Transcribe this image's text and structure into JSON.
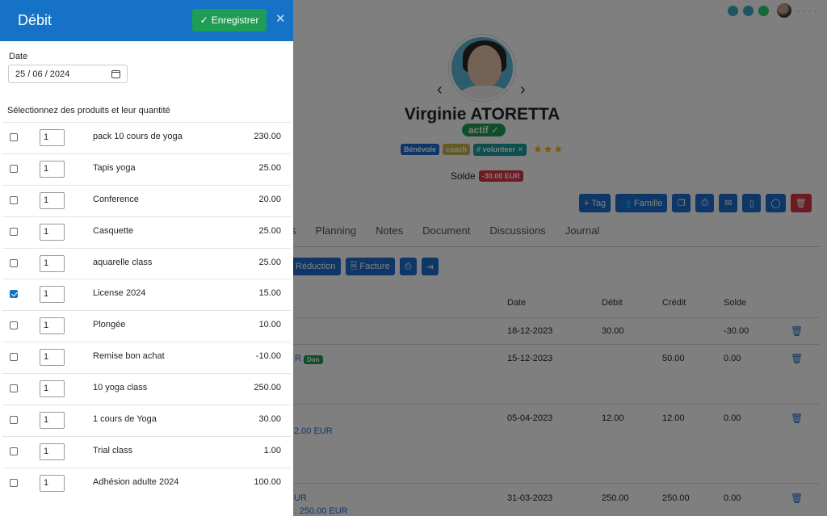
{
  "drawer": {
    "title": "Débit",
    "save_label": "Enregistrer",
    "date_label": "Date",
    "date_value": "25 / 06 / 2024",
    "products_label": "Sélectionnez des produits et leur quantité",
    "products": [
      {
        "name": "pack 10 cours de yoga",
        "qty": "1",
        "price": "230.00",
        "checked": false
      },
      {
        "name": "Tapis yoga",
        "qty": "1",
        "price": "25.00",
        "checked": false
      },
      {
        "name": "Conference",
        "qty": "1",
        "price": "20.00",
        "checked": false
      },
      {
        "name": "Casquette",
        "qty": "1",
        "price": "25.00",
        "checked": false
      },
      {
        "name": "aquarelle class",
        "qty": "1",
        "price": "25.00",
        "checked": false
      },
      {
        "name": "License 2024",
        "qty": "1",
        "price": "15.00",
        "checked": true
      },
      {
        "name": "Plongée",
        "qty": "1",
        "price": "10.00",
        "checked": false
      },
      {
        "name": "Remise bon achat",
        "qty": "1",
        "price": "-10.00",
        "checked": false
      },
      {
        "name": "10 yoga class",
        "qty": "1",
        "price": "250.00",
        "checked": false
      },
      {
        "name": "1 cours de Yoga",
        "qty": "1",
        "price": "30.00",
        "checked": false
      },
      {
        "name": "Trial class",
        "qty": "1",
        "price": "1.00",
        "checked": false
      },
      {
        "name": "Adhésion adulte 2024",
        "qty": "1",
        "price": "100.00",
        "checked": false
      }
    ]
  },
  "profile": {
    "name": "Virginie ATORETTA",
    "status": "actif",
    "tags": [
      "Bénévole",
      "coach",
      "# volunteer"
    ],
    "stars": "★★★",
    "solde_label": "Solde",
    "solde_value": "-30.00 EUR"
  },
  "actions": {
    "tag_label": "Tag",
    "famille_label": "Famille"
  },
  "tabs": [
    "s",
    "Planning",
    "Notes",
    "Document",
    "Discussions",
    "Journal"
  ],
  "subactions": {
    "reduction_label": "Réduction",
    "facture_label": "Facture"
  },
  "table": {
    "headers": {
      "date": "Date",
      "debit": "Débit",
      "credit": "Crédit",
      "solde": "Solde"
    },
    "rows": [
      {
        "date": "18-12-2023",
        "debit": "30.00",
        "credit": "",
        "solde": "-30.00",
        "desc": ""
      },
      {
        "date": "15-12-2023",
        "debit": "",
        "credit": "50.00",
        "solde": "0.00",
        "desc": "R",
        "badge": "Don"
      },
      {
        "date": "05-04-2023",
        "debit": "12.00",
        "credit": "12.00",
        "solde": "0.00",
        "desc": "2.00 EUR"
      },
      {
        "date": "31-03-2023",
        "debit": "250.00",
        "credit": "250.00",
        "solde": "0.00",
        "desc": "UR",
        "desc2": "s : 250.00 EUR"
      }
    ]
  },
  "colors": {
    "header_blue": "#1572c6",
    "save_green": "#1f9d55",
    "danger": "#dc3545",
    "primary": "#1d6fcf"
  }
}
